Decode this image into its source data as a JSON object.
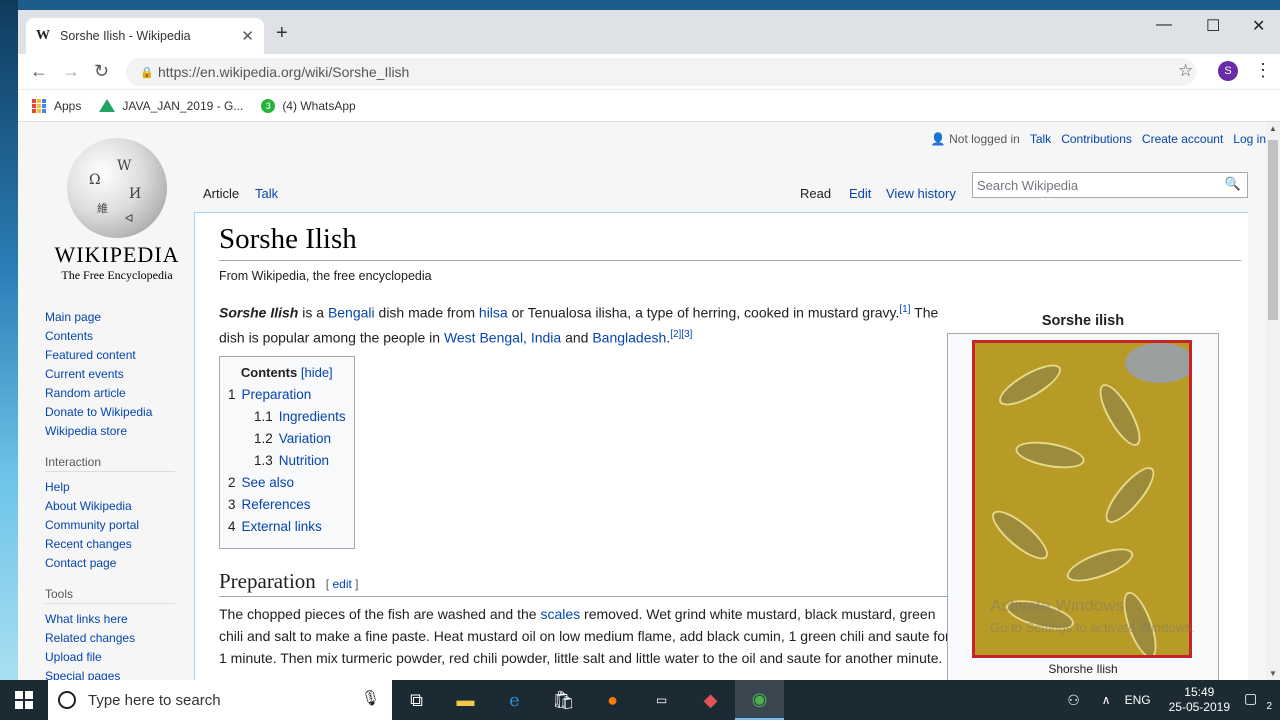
{
  "browser": {
    "tab_favicon": "W",
    "tab_title": "Sorshe Ilish - Wikipedia",
    "tab_close": "✕",
    "new_tab": "+",
    "url": "https://en.wikipedia.org/wiki/Sorshe_Ilish",
    "profile_initial": "S",
    "bookmarks": [
      {
        "label": "Apps"
      },
      {
        "label": "JAVA_JAN_2019 - G..."
      },
      {
        "label": "(4) WhatsApp",
        "badge": "3"
      }
    ]
  },
  "wiki": {
    "wordmark": "WIKIPEDIA",
    "tagline": "The Free Encyclopedia",
    "personal": {
      "not_logged_in": "Not logged in",
      "talk": "Talk",
      "contributions": "Contributions",
      "create_account": "Create account",
      "log_in": "Log in"
    },
    "tabs": {
      "article": "Article",
      "talk": "Talk",
      "read": "Read",
      "edit": "Edit",
      "history": "View history"
    },
    "search_placeholder": "Search Wikipedia",
    "nav_main": [
      "Main page",
      "Contents",
      "Featured content",
      "Current events",
      "Random article",
      "Donate to Wikipedia",
      "Wikipedia store"
    ],
    "interaction_heading": "Interaction",
    "nav_interaction": [
      "Help",
      "About Wikipedia",
      "Community portal",
      "Recent changes",
      "Contact page"
    ],
    "tools_heading": "Tools",
    "nav_tools": [
      "What links here",
      "Related changes",
      "Upload file",
      "Special pages"
    ],
    "title": "Sorshe Ilish",
    "site_sub": "From Wikipedia, the free encyclopedia",
    "intro": {
      "bold": "Sorshe Ilish",
      "t1": " is a ",
      "l1": "Bengali",
      "t2": " dish made from ",
      "l2": "hilsa",
      "t3": " or Tenualosa ilisha, a type of herring, cooked in mustard gravy.",
      "ref1": "[1]",
      "t4": " The dish is popular among the people in ",
      "l3": "West Bengal, India",
      "t5": " and ",
      "l4": "Bangladesh",
      "t6": ".",
      "ref2": "[2][3]"
    },
    "toc": {
      "title": "Contents",
      "hide": "[hide]",
      "items": [
        {
          "num": "1",
          "text": "Preparation"
        },
        {
          "num": "1.1",
          "text": "Ingredients"
        },
        {
          "num": "1.2",
          "text": "Variation"
        },
        {
          "num": "1.3",
          "text": "Nutrition"
        },
        {
          "num": "2",
          "text": "See also"
        },
        {
          "num": "3",
          "text": "References"
        },
        {
          "num": "4",
          "text": "External links"
        }
      ]
    },
    "section": {
      "heading": "Preparation",
      "edit_open": "[ ",
      "edit": "edit",
      "edit_close": " ]",
      "p1": "The chopped pieces of the fish are washed and the ",
      "p_link": "scales",
      "p2": " removed. Wet grind white mustard, black mustard, green chili and salt to make a fine paste. Heat mustard oil on low medium flame, add black cumin, 1 green chili and saute for 1 minute. Then mix turmeric powder, red chili powder, little salt and little water to the oil and saute for another minute."
    },
    "infobox": {
      "title": "Sorshe ilish",
      "caption": "Shorshe Ilish"
    }
  },
  "overlay": {
    "activate": "Activate Windows",
    "activate_sub": "Go to Settings to activate Windows."
  },
  "taskbar": {
    "search_placeholder": "Type here to search",
    "lang": "ENG",
    "time": "15:49",
    "date": "25-05-2019",
    "notif_count": "2"
  }
}
